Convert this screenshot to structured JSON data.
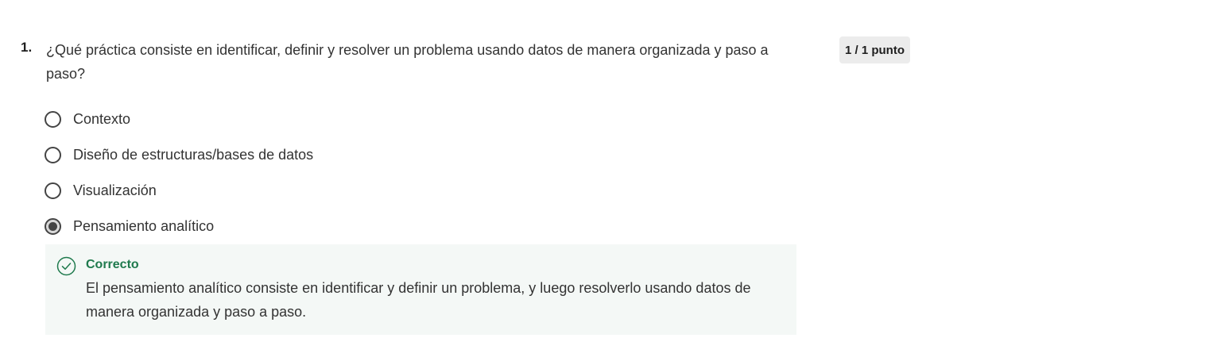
{
  "question": {
    "number": "1.",
    "text": "¿Qué práctica consiste en identificar, definir y resolver un problema usando datos de manera organizada y paso a paso?",
    "points": "1 / 1 punto",
    "options": [
      {
        "label": "Contexto",
        "selected": false
      },
      {
        "label": "Diseño de estructuras/bases de datos",
        "selected": false
      },
      {
        "label": "Visualización",
        "selected": false
      },
      {
        "label": "Pensamiento analítico",
        "selected": true
      }
    ]
  },
  "feedback": {
    "status": "Correcto",
    "icon": "check-circle-icon",
    "color": "#1f7a4d",
    "text": "El pensamiento analítico consiste en identificar y definir un problema, y luego resolverlo usando datos de manera organizada y paso a paso."
  }
}
